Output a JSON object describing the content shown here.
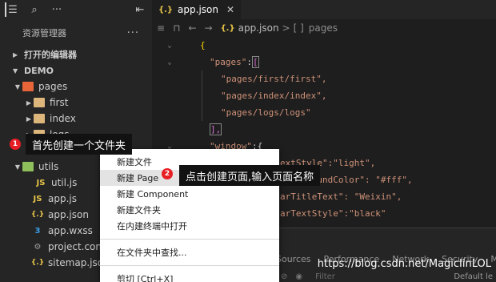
{
  "sidebar": {
    "toolbar": {
      "icons": [
        "list-icon",
        "search-icon",
        "more-icon",
        "collapse-panel-icon"
      ]
    },
    "title": "资源管理器",
    "title_more": "···",
    "sections": {
      "open_editors": "打开的编辑器",
      "project": "DEMO"
    },
    "tree": {
      "pages": "pages",
      "first": "first",
      "index": "index",
      "logs": "logs",
      "utils": "utils",
      "util_js": "util.js",
      "app_js": "app.js",
      "app_json": "app.json",
      "app_wxss": "app.wxss",
      "project_config": "project.confi",
      "sitemap_json": "sitemap.json"
    }
  },
  "editor": {
    "tab": {
      "icon": "{.}",
      "label": "app.json",
      "close": "✕"
    },
    "breadcrumb": {
      "file_icon": "{.}",
      "file": "app.json",
      "separator": ">",
      "array_icon": "[ ]",
      "item": "pages"
    },
    "code": {
      "l1": "{",
      "l2_key": "\"pages\"",
      "l2_colon": ":",
      "l2_bracket": "[",
      "l3": "\"pages/first/first\",",
      "l4": "\"pages/index/index\",",
      "l5": "\"pages/logs/logs\"",
      "l6": "],",
      "l7_key": "\"window\"",
      "l7_rest": ":{",
      "l8_tail": "extStyle\":\"light\",",
      "l9_tail": "rackgroundColor\": \"#fff\",",
      "l10_tail": "arTitleText\": \"Weixin\",",
      "l11_tail": "arTextStyle\":\"black\""
    }
  },
  "panel": {
    "tabs": [
      "Sources",
      "Performance",
      "Network",
      "Security",
      "Mo"
    ],
    "filter_placeholder": "Filter",
    "default_levels": "Default le"
  },
  "context_menu": {
    "items": [
      "新建文件",
      "新建 Page",
      "新建 Component",
      "新建文件夹",
      "在内建终端中打开",
      "在文件夹中查找...",
      "剪切   [Ctrl+X]"
    ]
  },
  "annotations": {
    "step1_num": "1",
    "step1_text": "首先创建一个文件夹",
    "step2_num": "2",
    "step2_text": "点击创建页面,输入页面名称"
  },
  "watermark": "https://blog.csdn.net/MagicIinLOL",
  "colors": {
    "background": "#1e1e1e",
    "sidebar": "#252526",
    "badge": "#e81e25",
    "string": "#ce9178"
  }
}
